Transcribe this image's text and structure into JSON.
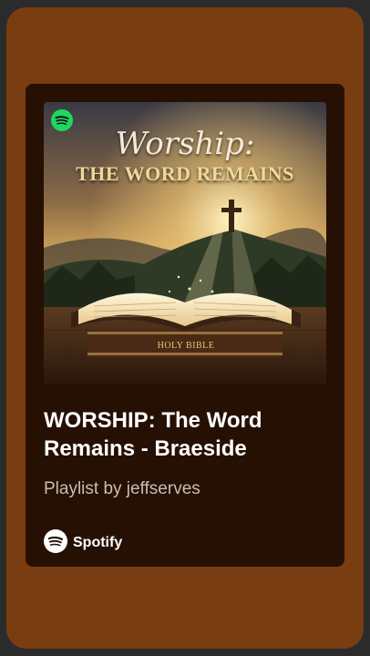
{
  "cover": {
    "title_script": "Worship:",
    "title_main": "THE WORD REMAINS",
    "book_label": "HOLY BIBLE",
    "badge_icon": "spotify-icon"
  },
  "playlist": {
    "title": "WORSHIP: The Word Remains - Braeside",
    "subtitle": "Playlist by jeffserves"
  },
  "brand": {
    "icon": "spotify-logo-icon",
    "name": "Spotify"
  },
  "colors": {
    "outer_bg": "#7a3d12",
    "card_bg": "#261003",
    "spotify_green": "#1ed760"
  }
}
